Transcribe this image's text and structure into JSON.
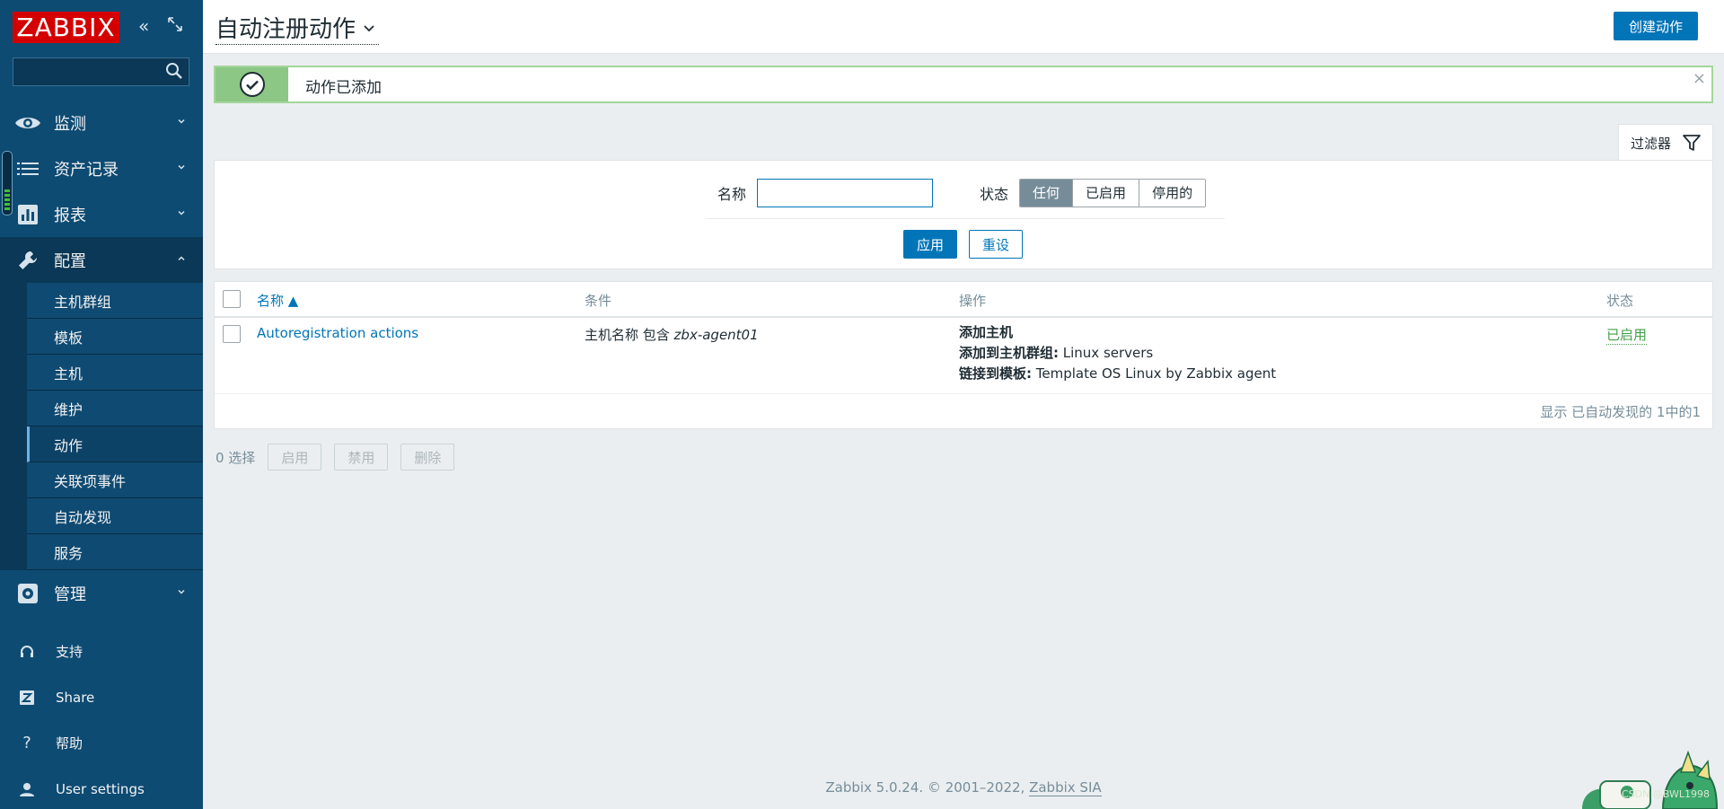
{
  "brand": {
    "logo": "ZABBIX"
  },
  "sidebar": {
    "search_placeholder": "",
    "nav": [
      {
        "label": "监测",
        "icon": "eye-icon"
      },
      {
        "label": "资产记录",
        "icon": "list-icon"
      },
      {
        "label": "报表",
        "icon": "bar-chart-icon"
      },
      {
        "label": "配置",
        "icon": "wrench-icon"
      }
    ],
    "config_items": [
      "主机群组",
      "模板",
      "主机",
      "维护",
      "动作",
      "关联项事件",
      "自动发现",
      "服务"
    ],
    "admin": {
      "label": "管理",
      "icon": "gear-icon"
    },
    "lower": [
      {
        "label": "支持",
        "icon": "headset-icon"
      },
      {
        "label": "Share",
        "icon": "share-z-icon"
      },
      {
        "label": "帮助",
        "icon": "question-icon"
      },
      {
        "label": "User settings",
        "icon": "user-icon"
      }
    ]
  },
  "header": {
    "title": "自动注册动作",
    "create_button": "创建动作"
  },
  "message": {
    "text": "动作已添加",
    "close": "×"
  },
  "filter": {
    "tab_label": "过滤器",
    "name_label": "名称",
    "name_value": "",
    "status_label": "状态",
    "status_options": [
      "任何",
      "已启用",
      "停用的"
    ],
    "status_selected": "任何",
    "apply": "应用",
    "reset": "重设"
  },
  "table": {
    "columns": {
      "name": "名称",
      "conditions": "条件",
      "operations": "操作",
      "status": "状态"
    },
    "rows": [
      {
        "name": "Autoregistration actions",
        "condition_prefix": "主机名称 包含 ",
        "condition_value": "zbx-agent01",
        "op_add_host": "添加主机",
        "op_group_label": "添加到主机群组:",
        "op_group_value": " Linux servers",
        "op_template_label": "链接到模板:",
        "op_template_value": " Template OS Linux by Zabbix agent",
        "status": "已启用"
      }
    ],
    "footer": "显示 已自动发现的 1中的1"
  },
  "actions": {
    "selected": "0 选择",
    "enable": "启用",
    "disable": "禁用",
    "delete": "删除"
  },
  "footer": {
    "text": "Zabbix 5.0.24. © 2001–2022, ",
    "link": "Zabbix SIA"
  },
  "watermark": "CSDN @BWL1998",
  "colors": {
    "sidebar": "#0e4b73",
    "accent": "#0275b8",
    "logo": "#d40000",
    "success": "#429e47"
  }
}
